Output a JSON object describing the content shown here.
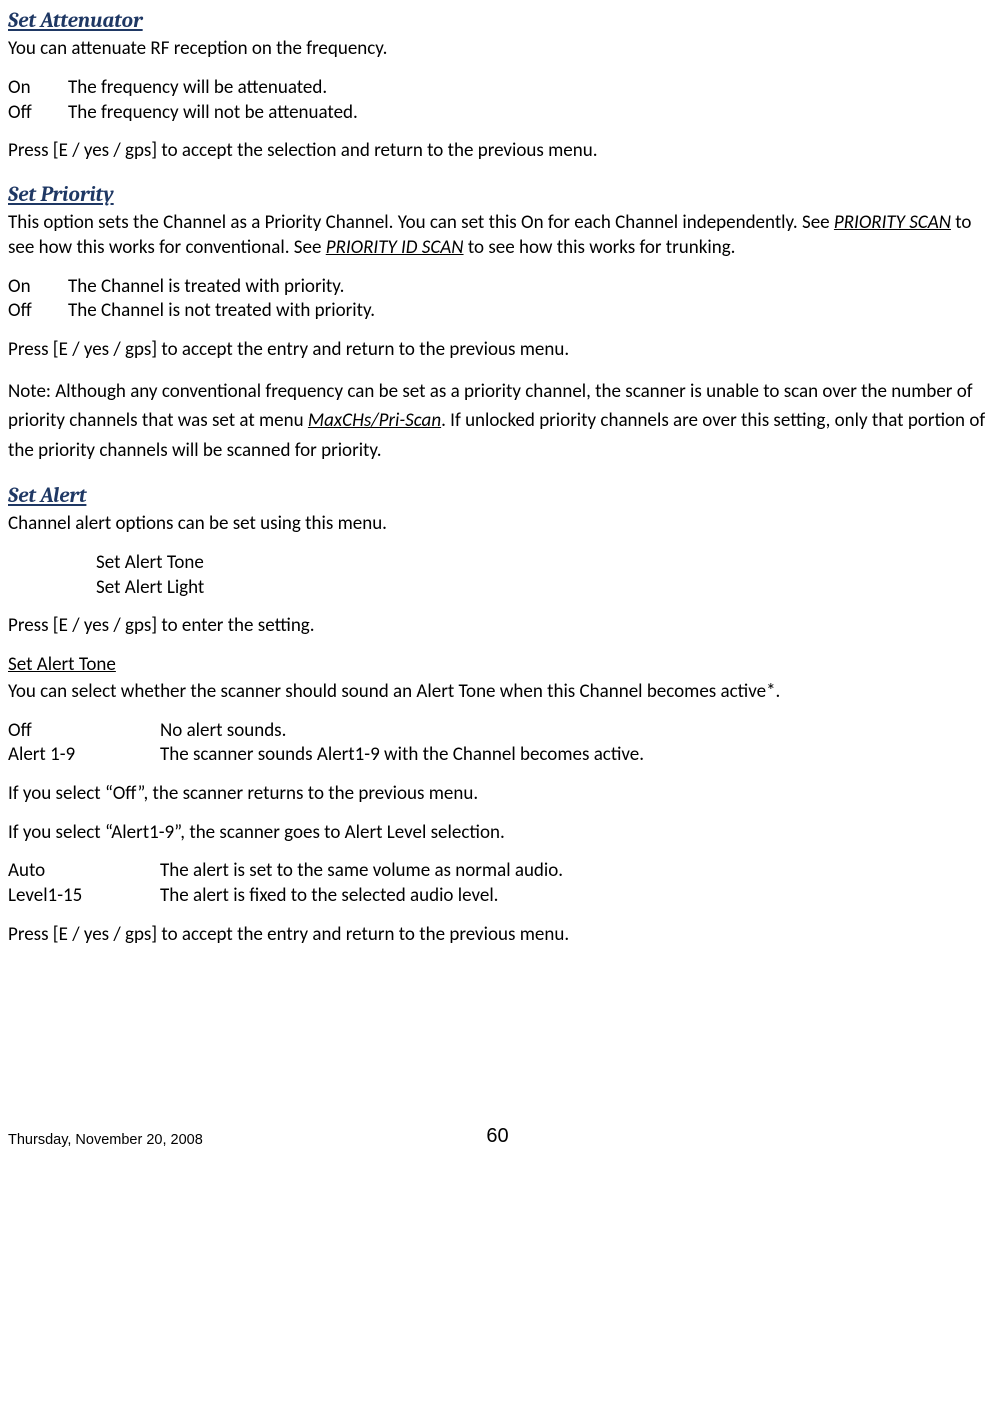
{
  "sections": {
    "attenuator": {
      "heading": "Set Attenuator",
      "intro": "You can attenuate RF reception on the frequency.",
      "opts": [
        {
          "label": "On",
          "desc": "The frequency will be attenuated."
        },
        {
          "label": "Off",
          "desc": "The frequency will not be attenuated."
        }
      ],
      "press": "Press [E / yes / gps] to accept the selection and return to the previous menu."
    },
    "priority": {
      "heading": "Set Priority",
      "intro_a": "This option sets the Channel as a Priority Channel. You can set this On for each Channel independently. See ",
      "link1": "PRIORITY SCAN",
      "intro_b": " to see how this works for conventional. See ",
      "link2": "PRIORITY ID SCAN",
      "intro_c": " to see how this works for trunking.",
      "opts": [
        {
          "label": "On",
          "desc": "The Channel is treated with priority."
        },
        {
          "label": "Off",
          "desc": "The Channel is not treated with priority."
        }
      ],
      "press": "Press [E / yes / gps] to accept the entry and return to the previous menu.",
      "note_a": "Note: Although any conventional frequency can be set as a priority channel, the scanner is unable to scan over the number of priority channels that was set at menu ",
      "note_link": "MaxCHs/Pri-Scan",
      "note_b": ". If unlocked priority channels are over this setting, only that portion of the priority channels will be scanned for priority."
    },
    "alert": {
      "heading": "Set Alert",
      "intro": "Channel alert options can be set using this menu.",
      "items": [
        "Set Alert Tone",
        "Set Alert Light"
      ],
      "press": "Press [E / yes / gps] to enter the setting.",
      "tone": {
        "sub": "Set Alert Tone",
        "intro": "You can select whether the scanner should sound an Alert Tone when this Channel becomes active*.",
        "opts1": [
          {
            "label": "Off",
            "desc": "No alert sounds."
          },
          {
            "label": "Alert 1-9",
            "desc": "The scanner sounds Alert1-9 with the Channel becomes active."
          }
        ],
        "if_off": "If you select “Off”, the scanner returns to the previous menu.",
        "if_alert": "If you select “Alert1-9”, the scanner  goes to Alert Level selection.",
        "opts2": [
          {
            "label": "Auto",
            "desc": "The alert is set to the same volume as normal audio."
          },
          {
            "label": "Level1-15",
            "desc": "The alert is fixed to the selected audio level."
          }
        ],
        "press": "Press [E / yes / gps] to accept the entry and return to the previous menu."
      }
    }
  },
  "footer": {
    "date": "Thursday, November 20, 2008",
    "page": "60"
  }
}
